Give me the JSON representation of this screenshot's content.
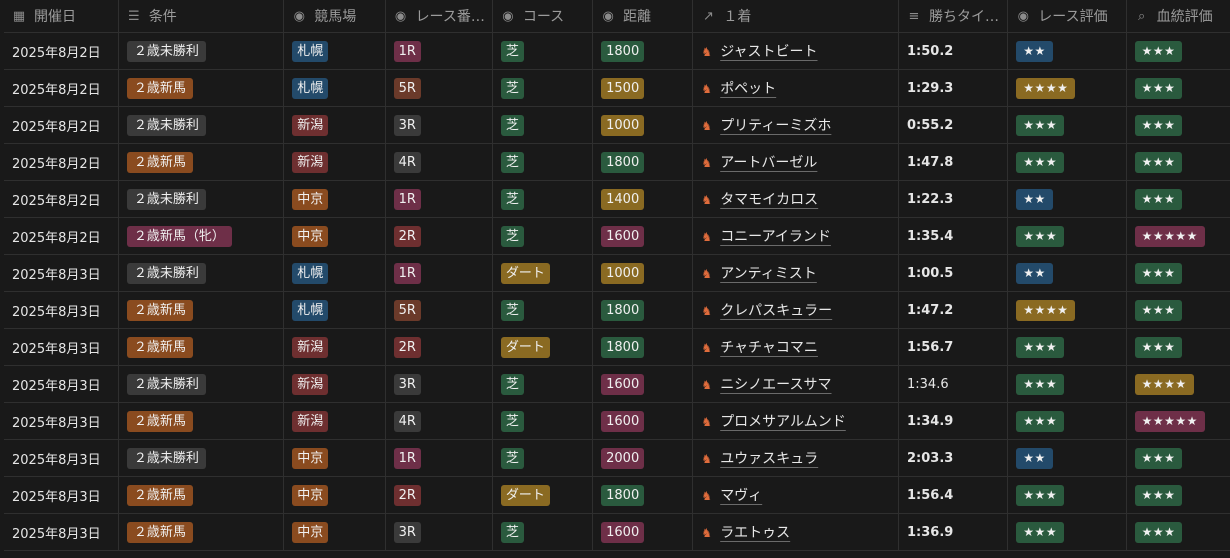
{
  "colors": {
    "gray": "#3a3a3a",
    "orange": "#8a4b1f",
    "blue": "#234a6a",
    "brown": "#6b3a2a",
    "yellow": "#8a6a22",
    "green": "#2a5a3e",
    "pink": "#6e2f48",
    "purple": "#5a3a6a",
    "red": "#6e2f30"
  },
  "headers": [
    {
      "label": "開催日",
      "icon": "calendar-icon",
      "glyph": "▦"
    },
    {
      "label": "条件",
      "icon": "list-icon",
      "glyph": "☰"
    },
    {
      "label": "競馬場",
      "icon": "select-icon",
      "glyph": "◉"
    },
    {
      "label": "レース番…",
      "icon": "select-icon",
      "glyph": "◉"
    },
    {
      "label": "コース",
      "icon": "select-icon",
      "glyph": "◉"
    },
    {
      "label": "距離",
      "icon": "select-icon",
      "glyph": "◉"
    },
    {
      "label": "１着",
      "icon": "arrow-up-right-icon",
      "glyph": "↗"
    },
    {
      "label": "勝ちタイ…",
      "icon": "text-icon",
      "glyph": "≡"
    },
    {
      "label": "レース評価",
      "icon": "select-icon",
      "glyph": "◉"
    },
    {
      "label": "血統評価",
      "icon": "search-icon",
      "glyph": "⌕"
    }
  ],
  "rows": [
    {
      "date": "2025年8月2日",
      "cond": "２歳未勝利",
      "cond_c": "gray",
      "venue": "札幌",
      "venue_c": "blue",
      "race": "1R",
      "race_c": "pink",
      "course": "芝",
      "course_c": "green",
      "dist": "1800",
      "dist_c": "green",
      "winner": "ジャストビート",
      "time": "1:50.2",
      "bold": true,
      "rate": "★★",
      "rate_c": "blue",
      "blood": "★★★",
      "blood_c": "green"
    },
    {
      "date": "2025年8月2日",
      "cond": "２歳新馬",
      "cond_c": "orange",
      "venue": "札幌",
      "venue_c": "blue",
      "race": "5R",
      "race_c": "brown",
      "course": "芝",
      "course_c": "green",
      "dist": "1500",
      "dist_c": "yellow",
      "winner": "ポペット",
      "time": "1:29.3",
      "bold": true,
      "rate": "★★★★",
      "rate_c": "yellow",
      "blood": "★★★",
      "blood_c": "green"
    },
    {
      "date": "2025年8月2日",
      "cond": "２歳未勝利",
      "cond_c": "gray",
      "venue": "新潟",
      "venue_c": "red",
      "race": "3R",
      "race_c": "gray",
      "course": "芝",
      "course_c": "green",
      "dist": "1000",
      "dist_c": "yellow",
      "winner": "プリティーミズホ",
      "time": "0:55.2",
      "bold": true,
      "rate": "★★★",
      "rate_c": "green",
      "blood": "★★★",
      "blood_c": "green"
    },
    {
      "date": "2025年8月2日",
      "cond": "２歳新馬",
      "cond_c": "orange",
      "venue": "新潟",
      "venue_c": "red",
      "race": "4R",
      "race_c": "gray",
      "course": "芝",
      "course_c": "green",
      "dist": "1800",
      "dist_c": "green",
      "winner": "アートバーゼル",
      "time": "1:47.8",
      "bold": true,
      "rate": "★★★",
      "rate_c": "green",
      "blood": "★★★",
      "blood_c": "green"
    },
    {
      "date": "2025年8月2日",
      "cond": "２歳未勝利",
      "cond_c": "gray",
      "venue": "中京",
      "venue_c": "orange",
      "race": "1R",
      "race_c": "pink",
      "course": "芝",
      "course_c": "green",
      "dist": "1400",
      "dist_c": "yellow",
      "winner": "タマモイカロス",
      "time": "1:22.3",
      "bold": true,
      "rate": "★★",
      "rate_c": "blue",
      "blood": "★★★",
      "blood_c": "green"
    },
    {
      "date": "2025年8月2日",
      "cond": "２歳新馬（牝）",
      "cond_c": "pink",
      "venue": "中京",
      "venue_c": "orange",
      "race": "2R",
      "race_c": "red",
      "course": "芝",
      "course_c": "green",
      "dist": "1600",
      "dist_c": "pink",
      "winner": "コニーアイランド",
      "time": "1:35.4",
      "bold": true,
      "rate": "★★★",
      "rate_c": "green",
      "blood": "★★★★★",
      "blood_c": "pink"
    },
    {
      "date": "2025年8月3日",
      "cond": "２歳未勝利",
      "cond_c": "gray",
      "venue": "札幌",
      "venue_c": "blue",
      "race": "1R",
      "race_c": "pink",
      "course": "ダート",
      "course_c": "yellow",
      "dist": "1000",
      "dist_c": "yellow",
      "winner": "アンティミスト",
      "time": "1:00.5",
      "bold": true,
      "rate": "★★",
      "rate_c": "blue",
      "blood": "★★★",
      "blood_c": "green"
    },
    {
      "date": "2025年8月3日",
      "cond": "２歳新馬",
      "cond_c": "orange",
      "venue": "札幌",
      "venue_c": "blue",
      "race": "5R",
      "race_c": "brown",
      "course": "芝",
      "course_c": "green",
      "dist": "1800",
      "dist_c": "green",
      "winner": "クレパスキュラー",
      "time": "1:47.2",
      "bold": true,
      "rate": "★★★★",
      "rate_c": "yellow",
      "blood": "★★★",
      "blood_c": "green"
    },
    {
      "date": "2025年8月3日",
      "cond": "２歳新馬",
      "cond_c": "orange",
      "venue": "新潟",
      "venue_c": "red",
      "race": "2R",
      "race_c": "red",
      "course": "ダート",
      "course_c": "yellow",
      "dist": "1800",
      "dist_c": "green",
      "winner": "チャチャコマニ",
      "time": "1:56.7",
      "bold": true,
      "rate": "★★★",
      "rate_c": "green",
      "blood": "★★★",
      "blood_c": "green"
    },
    {
      "date": "2025年8月3日",
      "cond": "２歳未勝利",
      "cond_c": "gray",
      "venue": "新潟",
      "venue_c": "red",
      "race": "3R",
      "race_c": "gray",
      "course": "芝",
      "course_c": "green",
      "dist": "1600",
      "dist_c": "pink",
      "winner": "ニシノエースサマ",
      "time": "1:34.6",
      "bold": false,
      "rate": "★★★",
      "rate_c": "green",
      "blood": "★★★★",
      "blood_c": "yellow"
    },
    {
      "date": "2025年8月3日",
      "cond": "２歳新馬",
      "cond_c": "orange",
      "venue": "新潟",
      "venue_c": "red",
      "race": "4R",
      "race_c": "gray",
      "course": "芝",
      "course_c": "green",
      "dist": "1600",
      "dist_c": "pink",
      "winner": "プロメサアルムンド",
      "time": "1:34.9",
      "bold": true,
      "rate": "★★★",
      "rate_c": "green",
      "blood": "★★★★★",
      "blood_c": "pink"
    },
    {
      "date": "2025年8月3日",
      "cond": "２歳未勝利",
      "cond_c": "gray",
      "venue": "中京",
      "venue_c": "orange",
      "race": "1R",
      "race_c": "pink",
      "course": "芝",
      "course_c": "green",
      "dist": "2000",
      "dist_c": "pink",
      "winner": "ユウァスキュラ",
      "time": "2:03.3",
      "bold": true,
      "rate": "★★",
      "rate_c": "blue",
      "blood": "★★★",
      "blood_c": "green"
    },
    {
      "date": "2025年8月3日",
      "cond": "２歳新馬",
      "cond_c": "orange",
      "venue": "中京",
      "venue_c": "orange",
      "race": "2R",
      "race_c": "red",
      "course": "ダート",
      "course_c": "yellow",
      "dist": "1800",
      "dist_c": "green",
      "winner": "マヴィ",
      "time": "1:56.4",
      "bold": true,
      "rate": "★★★",
      "rate_c": "green",
      "blood": "★★★",
      "blood_c": "green"
    },
    {
      "date": "2025年8月3日",
      "cond": "２歳新馬",
      "cond_c": "orange",
      "venue": "中京",
      "venue_c": "orange",
      "race": "3R",
      "race_c": "gray",
      "course": "芝",
      "course_c": "green",
      "dist": "1600",
      "dist_c": "pink",
      "winner": "ラエトゥス",
      "time": "1:36.9",
      "bold": true,
      "rate": "★★★",
      "rate_c": "green",
      "blood": "★★★",
      "blood_c": "green"
    }
  ]
}
